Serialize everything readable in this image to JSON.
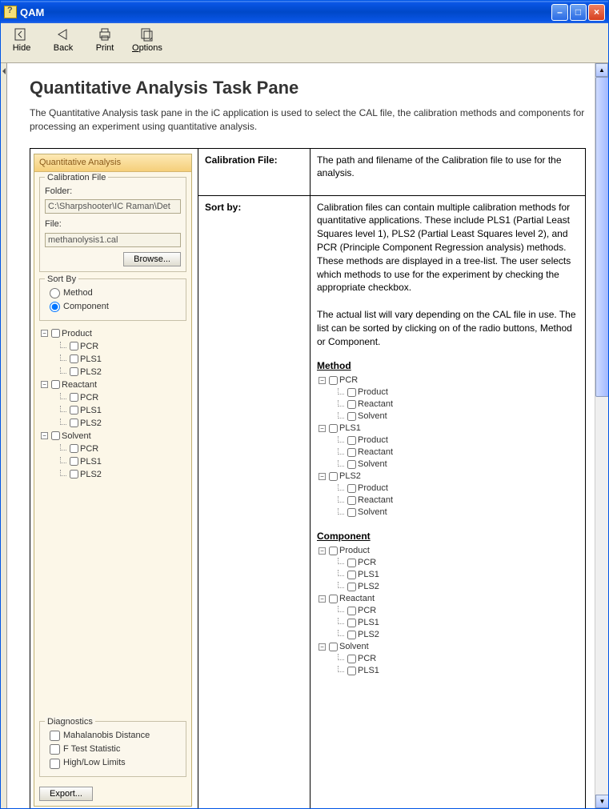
{
  "window": {
    "title": "QAM"
  },
  "toolbar": {
    "hide": "Hide",
    "back": "Back",
    "print": "Print",
    "options": "Options"
  },
  "doc": {
    "heading": "Quantitative Analysis Task Pane",
    "intro": "The Quantitative Analysis task pane in the iC application is used to select the CAL file, the calibration methods and components for processing an experiment using quantitative analysis."
  },
  "pane": {
    "title": "Quantitative Analysis",
    "calibration_group": "Calibration File",
    "folder_label": "Folder:",
    "folder_value": "C:\\Sharpshooter\\IC Raman\\Det",
    "file_label": "File:",
    "file_value": "methanolysis1.cal",
    "browse": "Browse...",
    "sortby_group": "Sort By",
    "sortby_method": "Method",
    "sortby_component": "Component",
    "tree": [
      {
        "label": "Product",
        "children": [
          "PCR",
          "PLS1",
          "PLS2"
        ]
      },
      {
        "label": "Reactant",
        "children": [
          "PCR",
          "PLS1",
          "PLS2"
        ]
      },
      {
        "label": "Solvent",
        "children": [
          "PCR",
          "PLS1",
          "PLS2"
        ]
      }
    ],
    "diagnostics_group": "Diagnostics",
    "diag_items": [
      "Mahalanobis Distance",
      "F Test Statistic",
      "High/Low Limits"
    ],
    "export": "Export..."
  },
  "table": {
    "row1": {
      "label": "Calibration File:",
      "desc": "The path and filename of the Calibration file to use for the analysis."
    },
    "row2": {
      "label": "Sort by:",
      "desc_p1": "Calibration files can contain multiple calibration methods for quantitative applications. These include PLS1 (Partial Least Squares level 1), PLS2 (Partial Least Squares level 2), and PCR (Principle Component Regression analysis) methods. These methods are displayed in a tree-list.  The user selects which methods to use for the experiment by checking the appropriate checkbox.",
      "desc_p2": "The actual list will vary depending on the CAL file in use. The list can be sorted by clicking on of the radio buttons, Method or Component.",
      "method_heading": "Method",
      "method_tree": [
        {
          "label": "PCR",
          "children": [
            "Product",
            "Reactant",
            "Solvent"
          ]
        },
        {
          "label": "PLS1",
          "children": [
            "Product",
            "Reactant",
            "Solvent"
          ]
        },
        {
          "label": "PLS2",
          "children": [
            "Product",
            "Reactant",
            "Solvent"
          ]
        }
      ],
      "component_heading": "Component",
      "component_tree": [
        {
          "label": "Product",
          "children": [
            "PCR",
            "PLS1",
            "PLS2"
          ]
        },
        {
          "label": "Reactant",
          "children": [
            "PCR",
            "PLS1",
            "PLS2"
          ]
        },
        {
          "label": "Solvent",
          "children": [
            "PCR",
            "PLS1"
          ]
        }
      ]
    }
  }
}
